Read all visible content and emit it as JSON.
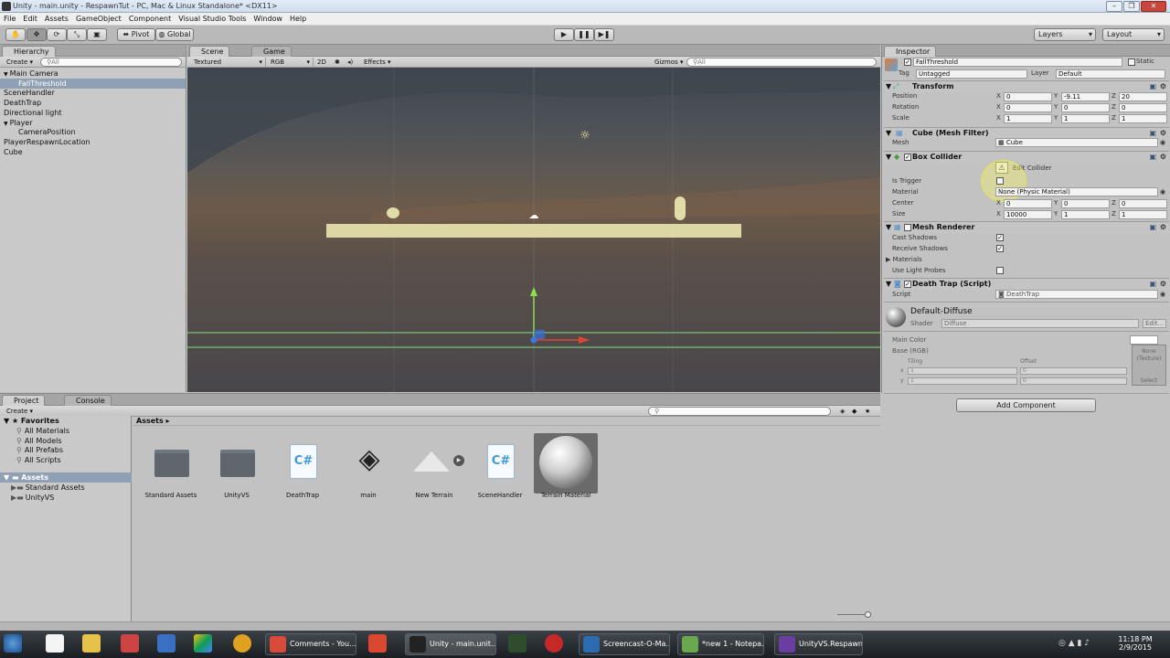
{
  "window": {
    "title": "Unity - main.unity - RespawnTut - PC, Mac & Linux Standalone* <DX11>"
  },
  "menu": [
    "File",
    "Edit",
    "Assets",
    "GameObject",
    "Component",
    "Visual Studio Tools",
    "Window",
    "Help"
  ],
  "toolbar": {
    "pivot": "Pivot",
    "global": "Global",
    "layers": "Layers",
    "layout": "Layout"
  },
  "hierarchy": {
    "tab": "Hierarchy",
    "create": "Create",
    "search_placeholder": "All",
    "items": [
      {
        "label": "Main Camera",
        "indent": 0,
        "expand": true
      },
      {
        "label": "FallThreshold",
        "indent": 1,
        "selected": true
      },
      {
        "label": "SceneHandler",
        "indent": 0
      },
      {
        "label": "DeathTrap",
        "indent": 0
      },
      {
        "label": "Directional light",
        "indent": 0
      },
      {
        "label": "Player",
        "indent": 0,
        "expand": true
      },
      {
        "label": "CameraPosition",
        "indent": 1
      },
      {
        "label": "PlayerRespawnLocation",
        "indent": 0
      },
      {
        "label": "Cube",
        "indent": 0
      }
    ]
  },
  "scene": {
    "tab_scene": "Scene",
    "tab_game": "Game",
    "shading": "Textured",
    "render": "RGB",
    "mode2d": "2D",
    "effects": "Effects",
    "gizmos": "Gizmos",
    "search_placeholder": "All"
  },
  "inspector": {
    "tab": "Inspector",
    "object_name": "FallThreshold",
    "static": "Static",
    "tag_label": "Tag",
    "tag": "Untagged",
    "layer_label": "Layer",
    "layer": "Default",
    "transform": {
      "title": "Transform",
      "rows": [
        {
          "label": "Position",
          "x": "0",
          "y": "-9.11",
          "z": "20"
        },
        {
          "label": "Rotation",
          "x": "0",
          "y": "0",
          "z": "0"
        },
        {
          "label": "Scale",
          "x": "1",
          "y": "1",
          "z": "1"
        }
      ]
    },
    "mesh_filter": {
      "title": "Cube (Mesh Filter)",
      "mesh_label": "Mesh",
      "mesh": "Cube"
    },
    "box_collider": {
      "title": "Box Collider",
      "edit": "Edit Collider",
      "is_trigger": "Is Trigger",
      "material_label": "Material",
      "material": "None (Physic Material)",
      "center_label": "Center",
      "center": {
        "x": "0",
        "y": "0",
        "z": "0"
      },
      "size_label": "Size",
      "size": {
        "x": "10000",
        "y": "1",
        "z": "1"
      }
    },
    "mesh_renderer": {
      "title": "Mesh Renderer",
      "cast": "Cast Shadows",
      "receive": "Receive Shadows",
      "materials": "Materials",
      "light_probes": "Use Light Probes"
    },
    "death_trap": {
      "title": "Death Trap (Script)",
      "script_label": "Script",
      "script": "DeathTrap"
    },
    "material": {
      "name": "Default-Diffuse",
      "shader_label": "Shader",
      "shader": "Diffuse",
      "edit": "Edit...",
      "main_color": "Main Color",
      "base": "Base (RGB)",
      "tiling": "Tiling",
      "offset": "Offset",
      "x": "x",
      "y": "y",
      "tx": "1",
      "ty": "1",
      "ox": "0",
      "oy": "0",
      "none": "None",
      "texture": "(Texture)",
      "select": "Select"
    },
    "add_component": "Add Component",
    "axes": {
      "x": "X",
      "y": "Y",
      "z": "Z"
    }
  },
  "project": {
    "tab_project": "Project",
    "tab_console": "Console",
    "create": "Create",
    "favorites": "Favorites",
    "fav_items": [
      "All Materials",
      "All Models",
      "All Prefabs",
      "All Scripts"
    ],
    "assets": "Assets",
    "asset_folders": [
      "Standard Assets",
      "UnityVS"
    ],
    "breadcrumb": "Assets",
    "items": [
      {
        "label": "Standard Assets",
        "kind": "folder"
      },
      {
        "label": "UnityVS",
        "kind": "folder"
      },
      {
        "label": "DeathTrap",
        "kind": "cs"
      },
      {
        "label": "main",
        "kind": "unity"
      },
      {
        "label": "New Terrain",
        "kind": "terrain"
      },
      {
        "label": "SceneHandler",
        "kind": "cs"
      },
      {
        "label": "Terrain Material",
        "kind": "material"
      }
    ]
  },
  "taskbar": {
    "apps": [
      {
        "label": "Comments - You...",
        "color": "#d94a3a"
      },
      {
        "label": "Unity - main.unit...",
        "color": "#222"
      },
      {
        "label": "Screencast-O-Ma...",
        "color": "#2b6cb0"
      },
      {
        "label": "*new 1 - Notepa...",
        "color": "#6aa84f"
      },
      {
        "label": "UnityVS.Respawn...",
        "color": "#6a3ea1"
      }
    ],
    "time": "11:18 PM",
    "date": "2/9/2015"
  }
}
